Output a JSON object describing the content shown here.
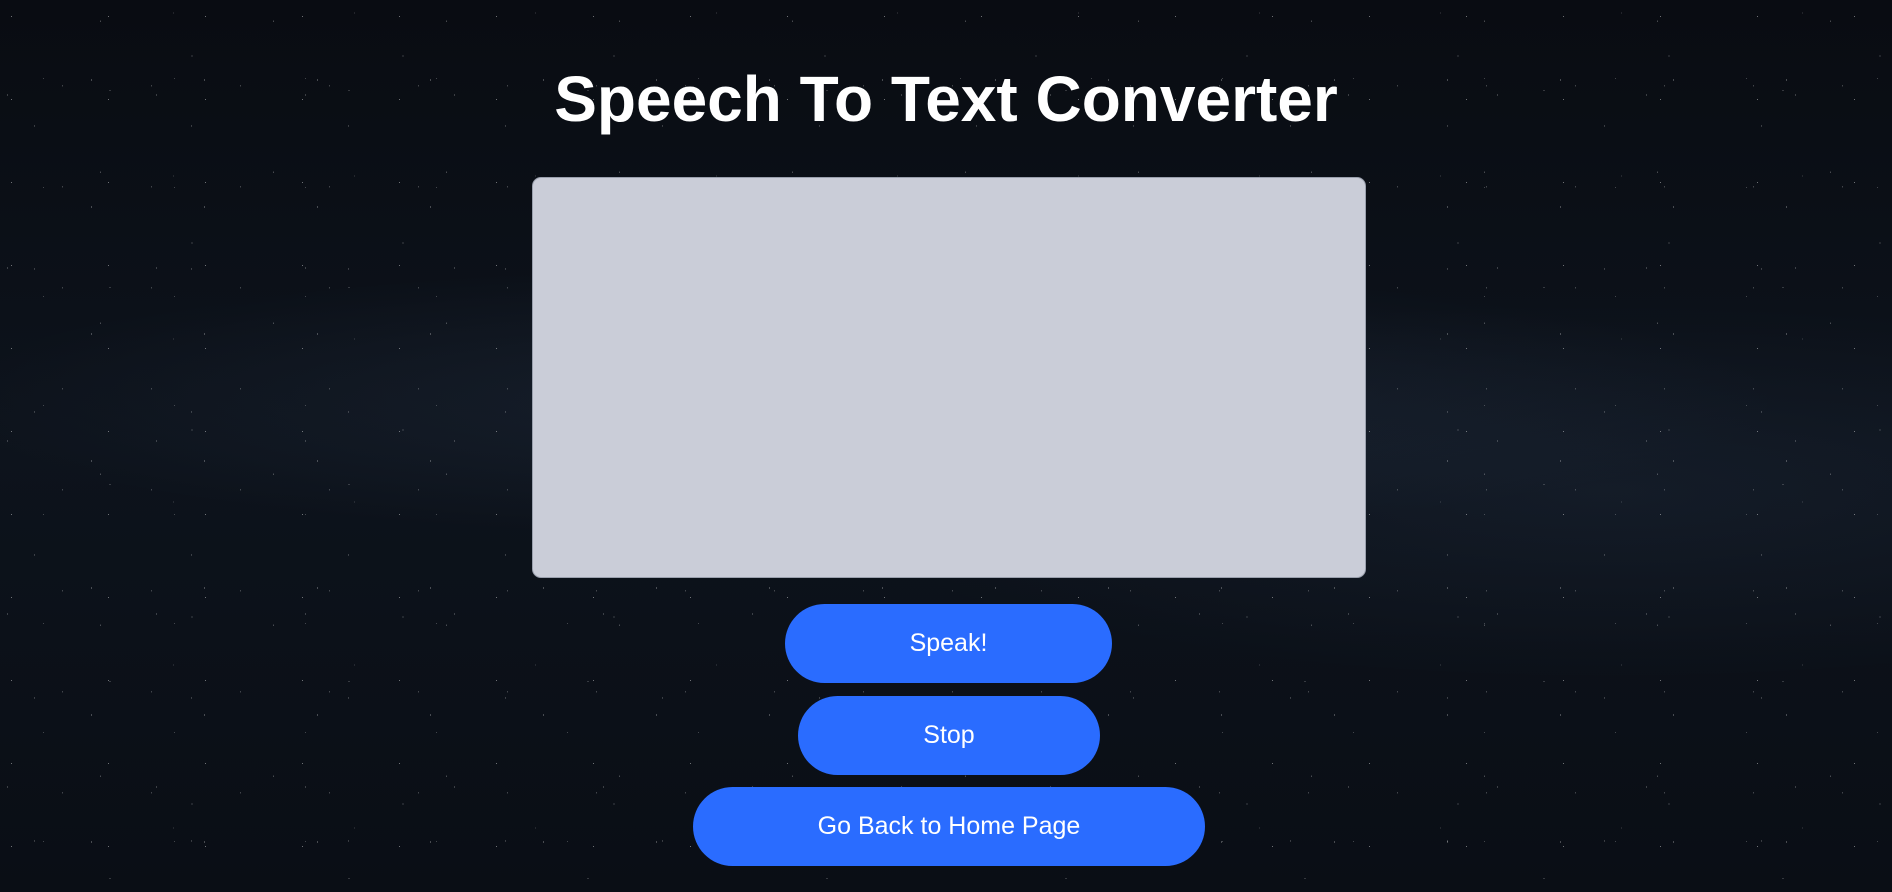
{
  "page": {
    "title": "Speech To Text Converter"
  },
  "transcript": {
    "value": "",
    "placeholder": ""
  },
  "buttons": {
    "speak_label": "Speak!",
    "stop_label": "Stop",
    "home_label": "Go Back to Home Page"
  },
  "colors": {
    "accent": "#2a6cff",
    "textarea_background": "#cacdd8",
    "page_background": "#0b0f16"
  }
}
